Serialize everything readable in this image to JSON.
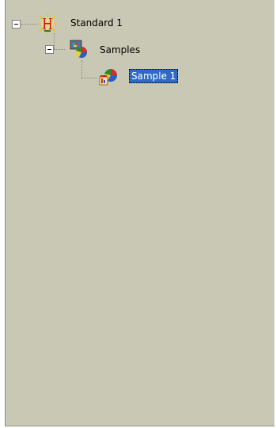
{
  "tree": {
    "root": {
      "label": "Standard 1",
      "icon": "hierarchy-h-icon",
      "expanded": true,
      "children": [
        {
          "label": "Samples",
          "icon": "samples-folder-icon",
          "expanded": true,
          "children": [
            {
              "label": "Sample 1",
              "icon": "sample-chart-icon",
              "selected": true
            }
          ]
        }
      ]
    }
  },
  "colors": {
    "panel_background": "#c9c8b4",
    "selection_background": "#316ac5"
  }
}
